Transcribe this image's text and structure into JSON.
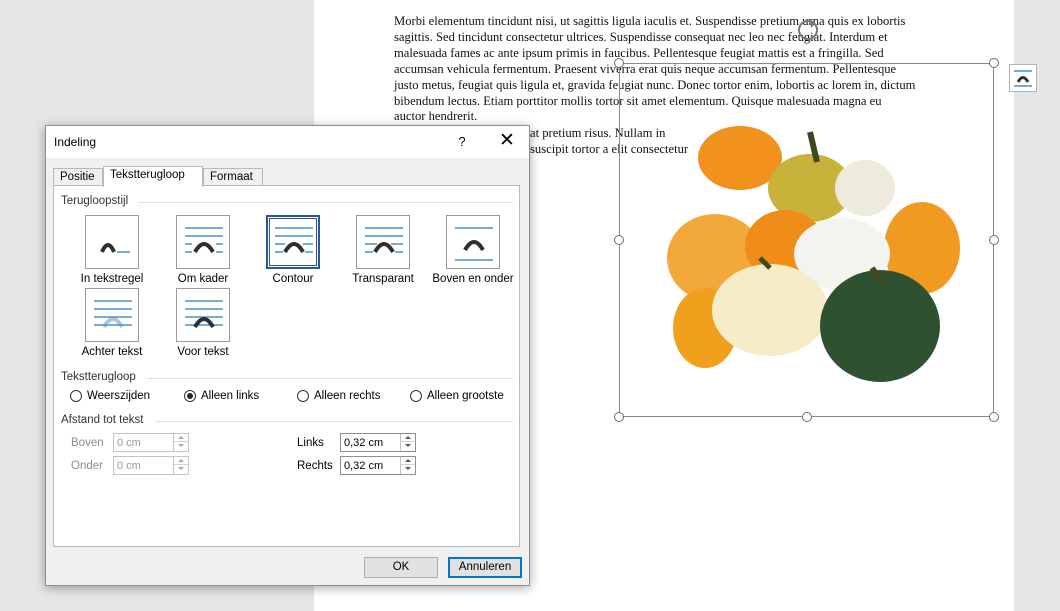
{
  "document": {
    "paragraphs": [
      "Morbi elementum tincidunt nisi, ut sagittis ligula iaculis et. Suspendisse pretium urna quis ex lobortis sagittis. Sed tincidunt consectetur ultrices. Suspendisse consequat nec leo nec feugiat. Interdum et malesuada fames ac ante ipsum primis in faucibus. Pellentesque feugiat mattis est a fringilla. Sed accumsan vehicula fermentum. Praesent viverra erat quis neque accumsan fermentum. Pellentesque justo metus, feugiat quis ligula et, gravida feugiat nunc. Donec tortor enim, lobortis ac lorem in, dictum bibendum lectus. Etiam porttitor mollis tortor sit amet elementum. Quisque malesuada magna eu auctor hendrerit.",
      "at pretium risus. Nullam in",
      "suscipit tortor a elit consectetur"
    ]
  },
  "dialog": {
    "title": "Indeling",
    "help_label": "?",
    "close_label": "✕",
    "tabs": [
      {
        "label": "Positie"
      },
      {
        "label": "Tekstterugloop"
      },
      {
        "label": "Formaat"
      }
    ],
    "sections": {
      "wrap_style": "Terugloopstijl",
      "wrap_text": "Tekstterugloop",
      "distance": "Afstand tot tekst"
    },
    "wrap_options": [
      {
        "label": "In tekstregel",
        "icon": "inline-wrap-icon"
      },
      {
        "label": "Om kader",
        "icon": "square-wrap-icon"
      },
      {
        "label": "Contour",
        "icon": "tight-wrap-icon",
        "selected": true
      },
      {
        "label": "Transparant",
        "icon": "through-wrap-icon"
      },
      {
        "label": "Boven en onder",
        "icon": "top-bottom-wrap-icon"
      },
      {
        "label": "Achter tekst",
        "icon": "behind-text-icon"
      },
      {
        "label": "Voor tekst",
        "icon": "in-front-text-icon"
      }
    ],
    "wrap_text_options": [
      {
        "label": "Weerszijden",
        "checked": false
      },
      {
        "label": "Alleen links",
        "checked": true
      },
      {
        "label": "Alleen rechts",
        "checked": false
      },
      {
        "label": "Alleen grootste",
        "checked": false
      }
    ],
    "distance": {
      "top_label": "Boven",
      "top_value": "0 cm",
      "bottom_label": "Onder",
      "bottom_value": "0 cm",
      "left_label": "Links",
      "left_value": "0,32 cm",
      "right_label": "Rechts",
      "right_value": "0,32 cm"
    },
    "ok_label": "OK",
    "cancel_label": "Annuleren"
  },
  "colors": {
    "accent": "#2b579a",
    "icon_lines": "#4a90c8",
    "icon_shape": "#2f2f2f"
  }
}
